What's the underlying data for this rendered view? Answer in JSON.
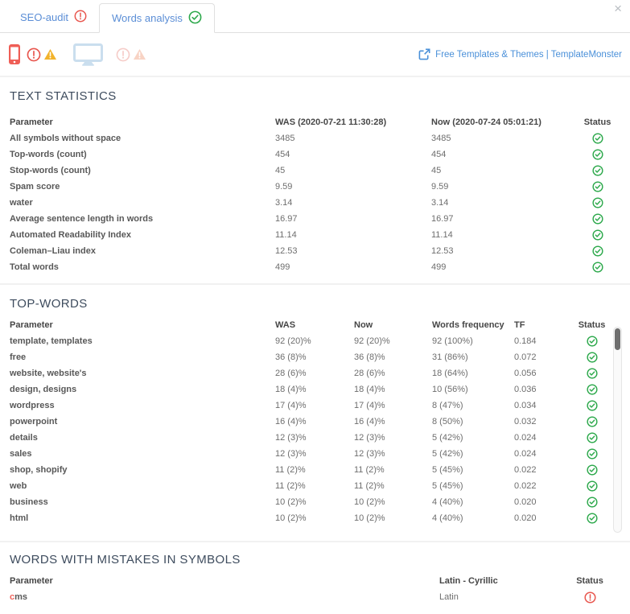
{
  "colors": {
    "tab_blue": "#5b8ed6",
    "link_blue": "#4a90d9",
    "status_green": "#2ba84a",
    "status_red": "#e8564e",
    "warning_orange": "#f2b32c"
  },
  "window": {
    "close": "×"
  },
  "tabs": [
    {
      "label": "SEO-audit",
      "status": "error",
      "active": false
    },
    {
      "label": "Words analysis",
      "status": "ok",
      "active": true
    }
  ],
  "toolbar": {
    "icons": [
      "mobile-icon",
      "alert-circle-icon",
      "warning-triangle-icon",
      "desktop-icon",
      "alert-circle-faded-icon",
      "warning-triangle-faded-icon"
    ],
    "link": "Free Templates & Themes | TemplateMonster"
  },
  "text_statistics": {
    "title": "TEXT STATISTICS",
    "columns": {
      "parameter": "Parameter",
      "was": "WAS (2020-07-21 11:30:28)",
      "now": "Now (2020-07-24 05:01:21)",
      "status": "Status"
    },
    "rows": [
      {
        "parameter": "All symbols without space",
        "was": "3485",
        "now": "3485",
        "status": "ok"
      },
      {
        "parameter": "Top-words (count)",
        "was": "454",
        "now": "454",
        "status": "ok"
      },
      {
        "parameter": "Stop-words (count)",
        "was": "45",
        "now": "45",
        "status": "ok"
      },
      {
        "parameter": "Spam score",
        "was": "9.59",
        "now": "9.59",
        "status": "ok"
      },
      {
        "parameter": "water",
        "was": "3.14",
        "now": "3.14",
        "status": "ok"
      },
      {
        "parameter": "Average sentence length in words",
        "was": "16.97",
        "now": "16.97",
        "status": "ok"
      },
      {
        "parameter": "Automated Readability Index",
        "was": "11.14",
        "now": "11.14",
        "status": "ok"
      },
      {
        "parameter": "Coleman–Liau index",
        "was": "12.53",
        "now": "12.53",
        "status": "ok"
      },
      {
        "parameter": "Total words",
        "was": "499",
        "now": "499",
        "status": "ok"
      }
    ]
  },
  "top_words": {
    "title": "TOP-WORDS",
    "columns": {
      "parameter": "Parameter",
      "was": "WAS",
      "now": "Now",
      "frequency": "Words frequency",
      "tf": "TF",
      "status": "Status"
    },
    "rows": [
      {
        "parameter": "template, templates",
        "was": "92 (20)%",
        "now": "92 (20)%",
        "frequency": "92 (100%)",
        "tf": "0.184",
        "status": "ok"
      },
      {
        "parameter": "free",
        "was": "36 (8)%",
        "now": "36 (8)%",
        "frequency": "31 (86%)",
        "tf": "0.072",
        "status": "ok"
      },
      {
        "parameter": "website, website's",
        "was": "28 (6)%",
        "now": "28 (6)%",
        "frequency": "18 (64%)",
        "tf": "0.056",
        "status": "ok"
      },
      {
        "parameter": "design, designs",
        "was": "18 (4)%",
        "now": "18 (4)%",
        "frequency": "10 (56%)",
        "tf": "0.036",
        "status": "ok"
      },
      {
        "parameter": "wordpress",
        "was": "17 (4)%",
        "now": "17 (4)%",
        "frequency": "8 (47%)",
        "tf": "0.034",
        "status": "ok"
      },
      {
        "parameter": "powerpoint",
        "was": "16 (4)%",
        "now": "16 (4)%",
        "frequency": "8 (50%)",
        "tf": "0.032",
        "status": "ok"
      },
      {
        "parameter": "details",
        "was": "12 (3)%",
        "now": "12 (3)%",
        "frequency": "5 (42%)",
        "tf": "0.024",
        "status": "ok"
      },
      {
        "parameter": "sales",
        "was": "12 (3)%",
        "now": "12 (3)%",
        "frequency": "5 (42%)",
        "tf": "0.024",
        "status": "ok"
      },
      {
        "parameter": "shop, shopify",
        "was": "11 (2)%",
        "now": "11 (2)%",
        "frequency": "5 (45%)",
        "tf": "0.022",
        "status": "ok"
      },
      {
        "parameter": "web",
        "was": "11 (2)%",
        "now": "11 (2)%",
        "frequency": "5 (45%)",
        "tf": "0.022",
        "status": "ok"
      },
      {
        "parameter": "business",
        "was": "10 (2)%",
        "now": "10 (2)%",
        "frequency": "4 (40%)",
        "tf": "0.020",
        "status": "ok"
      },
      {
        "parameter": "html",
        "was": "10 (2)%",
        "now": "10 (2)%",
        "frequency": "4 (40%)",
        "tf": "0.020",
        "status": "ok"
      }
    ]
  },
  "mistakes": {
    "title": "WORDS WITH MISTAKES IN SYMBOLS",
    "columns": {
      "parameter": "Parameter",
      "latin_cyrillic": "Latin - Cyrillic",
      "status": "Status"
    },
    "rows": [
      {
        "parameter_highlight": "c",
        "parameter_rest": "ms",
        "latin_cyrillic": "Latin",
        "status": "error"
      }
    ]
  }
}
